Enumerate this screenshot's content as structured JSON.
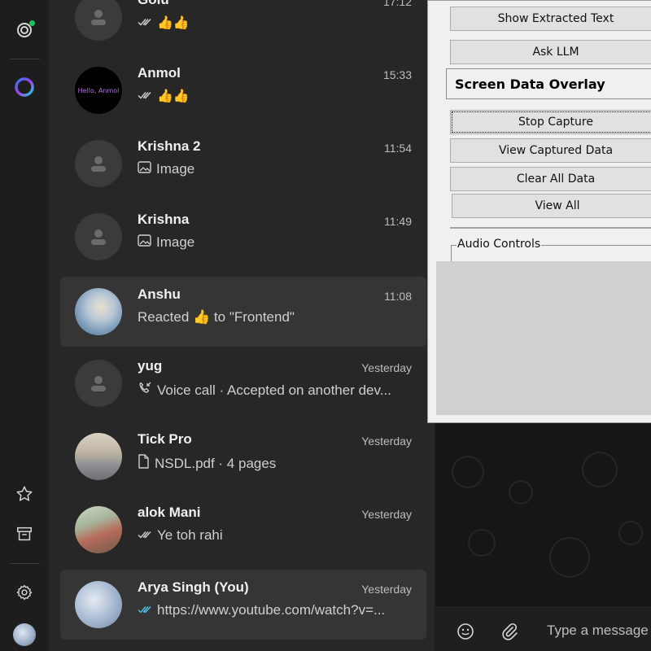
{
  "rail": {
    "status_icon": "status-icon",
    "meta_ai_icon": "meta-ai-icon",
    "starred_icon": "star-icon",
    "archived_icon": "archive-icon",
    "settings_icon": "gear-icon",
    "profile_icon": "avatar"
  },
  "chats": [
    {
      "name": "Golu",
      "time": "17:12",
      "preview": "👍👍",
      "ticks": "double-tick-grey",
      "avatar": "default"
    },
    {
      "name": "Anmol",
      "time": "15:33",
      "preview": "👍👍",
      "ticks": "double-tick-grey",
      "avatar": "Hello, Anmol"
    },
    {
      "name": "Krishna 2",
      "time": "11:54",
      "preview": "Image",
      "ticks": "image-icon",
      "avatar": "default"
    },
    {
      "name": "Krishna",
      "time": "11:49",
      "preview": "Image",
      "ticks": "image-icon",
      "avatar": "default"
    },
    {
      "name": "Anshu",
      "time": "11:08",
      "preview": "Reacted 👍 to \"Frontend\"",
      "ticks": "",
      "avatar": "photo"
    },
    {
      "name": "yug",
      "time": "Yesterday",
      "preview": "Voice call · Accepted on another dev...",
      "ticks": "call-icon",
      "avatar": "default"
    },
    {
      "name": "Tick Pro",
      "time": "Yesterday",
      "preview": "NSDL.pdf · 4 pages",
      "ticks": "document-icon",
      "avatar": "photo"
    },
    {
      "name": "alok Mani",
      "time": "Yesterday",
      "preview": "Ye toh rahi",
      "ticks": "double-tick-grey",
      "avatar": "photo"
    },
    {
      "name": "Arya Singh (You)",
      "time": "Yesterday",
      "preview": "https://www.youtube.com/watch?v=...",
      "ticks": "double-tick-blue",
      "avatar": "photo"
    }
  ],
  "overlay": {
    "show_extracted": "Show Extracted Text",
    "ask_llm": "Ask LLM",
    "title": "Screen Data Overlay",
    "stop_capture": "Stop Capture",
    "view_captured": "View Captured Data",
    "clear_all": "Clear All Data",
    "view_all": "View All",
    "audio_controls": "Audio Controls"
  },
  "composer": {
    "placeholder": "Type a message"
  },
  "colors": {
    "accent_green": "#21c063",
    "read_tick_blue": "#53bdeb"
  }
}
